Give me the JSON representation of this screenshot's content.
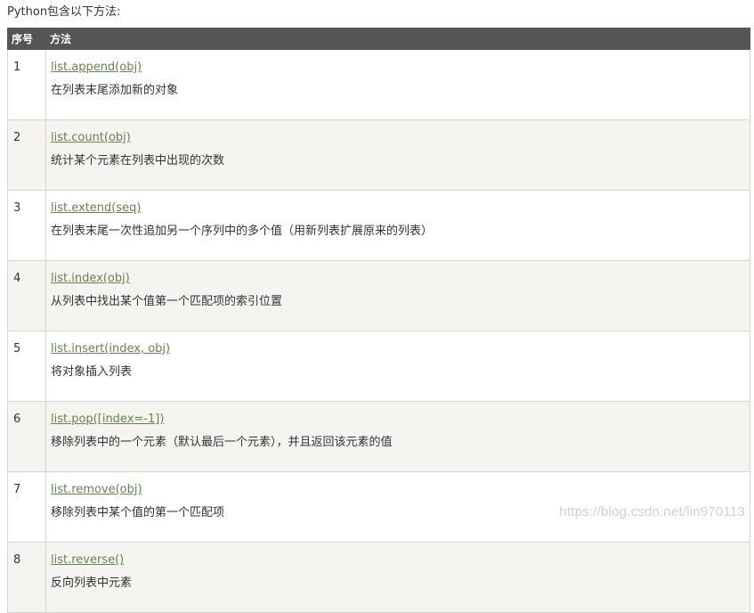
{
  "intro": "Python包含以下方法:",
  "table": {
    "headers": [
      "序号",
      "方法"
    ],
    "rows": [
      {
        "no": "1",
        "method": "list.append(obj)",
        "desc": "在列表末尾添加新的对象"
      },
      {
        "no": "2",
        "method": "list.count(obj)",
        "desc": "统计某个元素在列表中出现的次数"
      },
      {
        "no": "3",
        "method": "list.extend(seq)",
        "desc": "在列表末尾一次性追加另一个序列中的多个值（用新列表扩展原来的列表）"
      },
      {
        "no": "4",
        "method": "list.index(obj)",
        "desc": "从列表中找出某个值第一个匹配项的索引位置"
      },
      {
        "no": "5",
        "method": "list.insert(index, obj)",
        "desc": "将对象插入列表"
      },
      {
        "no": "6",
        "method": "list.pop([index=-1])",
        "desc": "移除列表中的一个元素（默认最后一个元素），并且返回该元素的值"
      },
      {
        "no": "7",
        "method": "list.remove(obj)",
        "desc": "移除列表中某个值的第一个匹配项"
      },
      {
        "no": "8",
        "method": "list.reverse()",
        "desc": "反向列表中元素"
      }
    ]
  },
  "watermark": "https://blog.csdn.net/lin970113",
  "colors": {
    "header_bg": "#555555",
    "link": "#64854c",
    "row_alt_bg": "#f6f4f0",
    "border": "#d4d4d4"
  }
}
